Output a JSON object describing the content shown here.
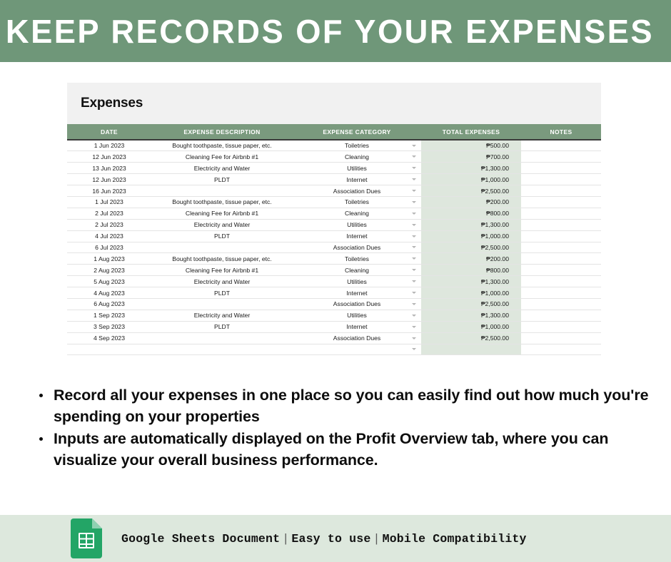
{
  "banner": {
    "title": "KEEP RECORDS OF YOUR EXPENSES",
    "bg_color": "#6f9779"
  },
  "sheet": {
    "title": "Expenses",
    "header_color": "#7a9a7e",
    "total_column_fill": "#dee7dd",
    "columns": [
      "DATE",
      "EXPENSE DESCRIPTION",
      "EXPENSE CATEGORY",
      "TOTAL EXPENSES",
      "NOTES"
    ],
    "rows": [
      {
        "date": "1 Jun 2023",
        "description": "Bought toothpaste, tissue paper, etc.",
        "category": "Toiletries",
        "total": "₱500.00",
        "notes": ""
      },
      {
        "date": "12 Jun 2023",
        "description": "Cleaning Fee for Airbnb #1",
        "category": "Cleaning",
        "total": "₱700.00",
        "notes": ""
      },
      {
        "date": "13 Jun 2023",
        "description": "Electricity and Water",
        "category": "Utilities",
        "total": "₱1,300.00",
        "notes": ""
      },
      {
        "date": "12 Jun 2023",
        "description": "PLDT",
        "category": "Internet",
        "total": "₱1,000.00",
        "notes": ""
      },
      {
        "date": "16 Jun 2023",
        "description": "",
        "category": "Association Dues",
        "total": "₱2,500.00",
        "notes": ""
      },
      {
        "date": "1 Jul 2023",
        "description": "Bought toothpaste, tissue paper, etc.",
        "category": "Toiletries",
        "total": "₱200.00",
        "notes": ""
      },
      {
        "date": "2 Jul 2023",
        "description": "Cleaning Fee for Airbnb #1",
        "category": "Cleaning",
        "total": "₱800.00",
        "notes": ""
      },
      {
        "date": "2 Jul 2023",
        "description": "Electricity and Water",
        "category": "Utilities",
        "total": "₱1,300.00",
        "notes": ""
      },
      {
        "date": "4 Jul 2023",
        "description": "PLDT",
        "category": "Internet",
        "total": "₱1,000.00",
        "notes": ""
      },
      {
        "date": "6 Jul 2023",
        "description": "",
        "category": "Association Dues",
        "total": "₱2,500.00",
        "notes": ""
      },
      {
        "date": "1 Aug 2023",
        "description": "Bought toothpaste, tissue paper, etc.",
        "category": "Toiletries",
        "total": "₱200.00",
        "notes": ""
      },
      {
        "date": "2 Aug 2023",
        "description": "Cleaning Fee for Airbnb #1",
        "category": "Cleaning",
        "total": "₱800.00",
        "notes": ""
      },
      {
        "date": "5 Aug 2023",
        "description": "Electricity and Water",
        "category": "Utilities",
        "total": "₱1,300.00",
        "notes": ""
      },
      {
        "date": "4 Aug 2023",
        "description": "PLDT",
        "category": "Internet",
        "total": "₱1,000.00",
        "notes": ""
      },
      {
        "date": "6 Aug 2023",
        "description": "",
        "category": "Association Dues",
        "total": "₱2,500.00",
        "notes": ""
      },
      {
        "date": "1 Sep 2023",
        "description": "Electricity and Water",
        "category": "Utilities",
        "total": "₱1,300.00",
        "notes": ""
      },
      {
        "date": "3 Sep 2023",
        "description": "PLDT",
        "category": "Internet",
        "total": "₱1,000.00",
        "notes": ""
      },
      {
        "date": "4 Sep 2023",
        "description": "",
        "category": "Association Dues",
        "total": "₱2,500.00",
        "notes": ""
      },
      {
        "date": "",
        "description": "",
        "category": "",
        "total": "",
        "notes": ""
      }
    ]
  },
  "bullets": [
    "Record all your expenses in one place so you can easily find out how much you're spending on your properties",
    "Inputs are automatically displayed on the Profit Overview tab, where you can visualize your overall business performance."
  ],
  "footer": {
    "bg_color": "#dde8dd",
    "icon": "google-sheets-icon",
    "part1": "Google Sheets Document",
    "sep1": "|",
    "part2": "Easy to use",
    "sep2": "|",
    "part3": "Mobile Compatibility"
  }
}
